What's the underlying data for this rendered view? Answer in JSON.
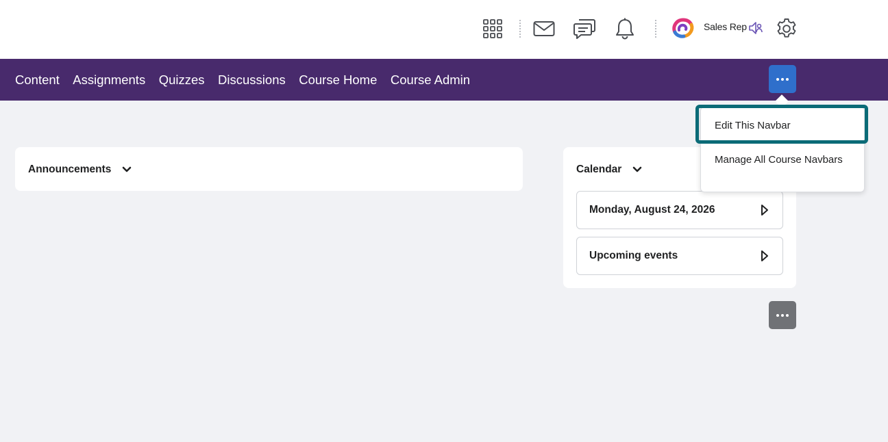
{
  "header": {
    "icons": {
      "apps": "waffle-grid-icon",
      "mail": "envelope-icon",
      "chat": "message-alert-icon",
      "notifications": "bell-icon",
      "logo": "org-logo-icon",
      "role": "role-switch-icon",
      "settings": "gear-icon"
    },
    "user_label": "Sales Rep"
  },
  "navbar": {
    "links": [
      "Content",
      "Assignments",
      "Quizzes",
      "Discussions",
      "Course Home",
      "Course Admin"
    ],
    "more_icon": "more-dots-icon",
    "background": "#482a6c",
    "more_button_color": "#2f6fcb"
  },
  "menu": {
    "items": [
      "Edit This Navbar",
      "Manage All Course Navbars"
    ],
    "highlight_color": "#0b6b77"
  },
  "widgets": {
    "announcements": {
      "title": "Announcements"
    },
    "calendar": {
      "title": "Calendar",
      "date_label": "Monday, August 24, 2026",
      "upcoming_label": "Upcoming events"
    }
  },
  "page": {
    "more_icon": "more-dots-icon",
    "more_button_color": "#707276"
  }
}
